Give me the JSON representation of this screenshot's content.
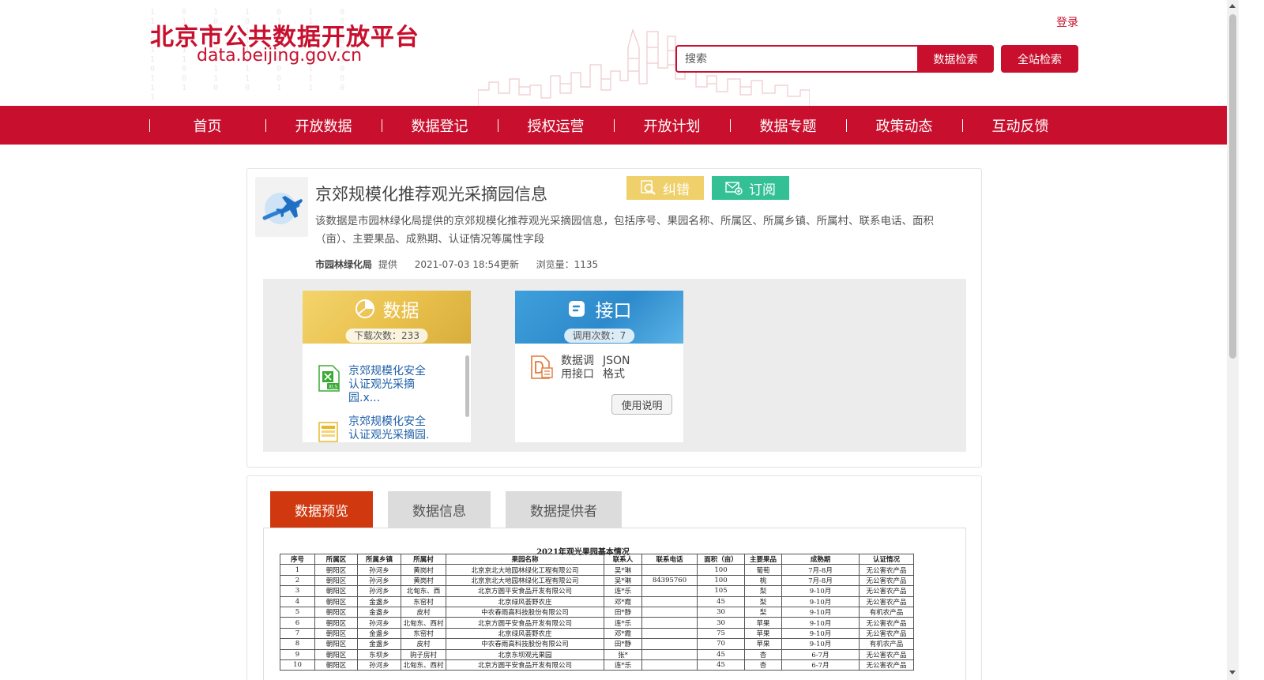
{
  "header": {
    "logo_cn": "北京市公共数据开放平台",
    "logo_en": "data.beijing.gov.cn",
    "login": "登录",
    "search_placeholder": "搜索",
    "btn_data_search": "数据检索",
    "btn_site_search": "全站检索"
  },
  "nav": [
    "首页",
    "开放数据",
    "数据登记",
    "授权运营",
    "开放计划",
    "数据专题",
    "政策动态",
    "互动反馈"
  ],
  "dataset": {
    "title": "京郊规模化推荐观光采摘园信息",
    "btn_correct": "纠错",
    "btn_subscribe": "订阅",
    "description": "该数据是市园林绿化局提供的京郊规模化推荐观光采摘园信息，包括序号、果园名称、所属区、所属乡镇、所属村、联系电话、面积（亩）、主要果品、成熟期、认证情况等属性字段",
    "provider": "市园林绿化局",
    "provider_suffix": "提供",
    "updated": "2021-07-03 18:54更新",
    "views": "浏览量：1135"
  },
  "data_card": {
    "title": "数据",
    "downloads": "下载次数：233",
    "files": [
      {
        "name": "京郊规模化安全认证观光采摘园.x...",
        "icon": "xls-file-icon",
        "color": "#3aaa35"
      },
      {
        "name": "京郊规模化安全认证观光采摘园.",
        "icon": "table-file-icon",
        "color": "#e8b82a"
      }
    ]
  },
  "api_card": {
    "title": "接口",
    "calls": "调用次数：7",
    "api_name": "数据调用接口",
    "api_format": "JSON格式",
    "btn_usage": "使用说明"
  },
  "tabs": [
    "数据预览",
    "数据信息",
    "数据提供者"
  ],
  "preview": {
    "caption": "2021年观光果园基本情况",
    "headers": [
      "序号",
      "所属区",
      "所属乡镇",
      "所属村",
      "果园名称",
      "联系人",
      "联系电话",
      "面积（亩）",
      "主要果品",
      "成熟期",
      "认证情况"
    ],
    "rows": [
      [
        "1",
        "朝阳区",
        "孙河乡",
        "黄岗村",
        "北京京北大地园林绿化工程有限公司",
        "吴*琳",
        "",
        "100",
        "葡萄",
        "7月-8月",
        "无公害农产品"
      ],
      [
        "2",
        "朝阳区",
        "孙河乡",
        "黄岗村",
        "北京京北大地园林绿化工程有限公司",
        "吴*琳",
        "84395760",
        "100",
        "桃",
        "7月-8月",
        "无公害农产品"
      ],
      [
        "3",
        "朝阳区",
        "孙河乡",
        "北甸东、西",
        "北京方圆平安食品开发有限公司",
        "连*乐",
        "",
        "105",
        "梨",
        "9-10月",
        "无公害农产品"
      ],
      [
        "4",
        "朝阳区",
        "金盏乡",
        "东窑村",
        "北京绿风荟野农庄",
        "邓*霞",
        "",
        "45",
        "梨",
        "9-10月",
        "无公害农产品"
      ],
      [
        "5",
        "朝阳区",
        "金盏乡",
        "皮村",
        "中农春雨高科技股份有限公司",
        "田*静",
        "",
        "30",
        "梨",
        "9-10月",
        "有机农产品"
      ],
      [
        "6",
        "朝阳区",
        "孙河乡",
        "北甸东、西村",
        "北京方圆平安食品开发有限公司",
        "连*乐",
        "",
        "30",
        "苹果",
        "9-10月",
        "无公害农产品"
      ],
      [
        "7",
        "朝阳区",
        "金盏乡",
        "东窑村",
        "北京绿风荟野农庄",
        "邓*霞",
        "",
        "75",
        "苹果",
        "9-10月",
        "无公害农产品"
      ],
      [
        "8",
        "朝阳区",
        "金盏乡",
        "皮村",
        "中农春雨高科技股份有限公司",
        "田*静",
        "",
        "70",
        "苹果",
        "9-10月",
        "有机农产品"
      ],
      [
        "9",
        "朝阳区",
        "东坝乡",
        "驹子房村",
        "北京东坝观光果园",
        "张*",
        "",
        "45",
        "杏",
        "6-7月",
        "无公害农产品"
      ],
      [
        "10",
        "朝阳区",
        "孙河乡",
        "北甸东、西村",
        "北京方圆平安食品开发有限公司",
        "连*乐",
        "",
        "45",
        "杏",
        "6-7月",
        "无公害农产品"
      ]
    ]
  },
  "colors": {
    "brand": "#c8102e",
    "correct": "#f0d06a",
    "subscribe": "#34c095",
    "active_tab": "#d0380f"
  }
}
